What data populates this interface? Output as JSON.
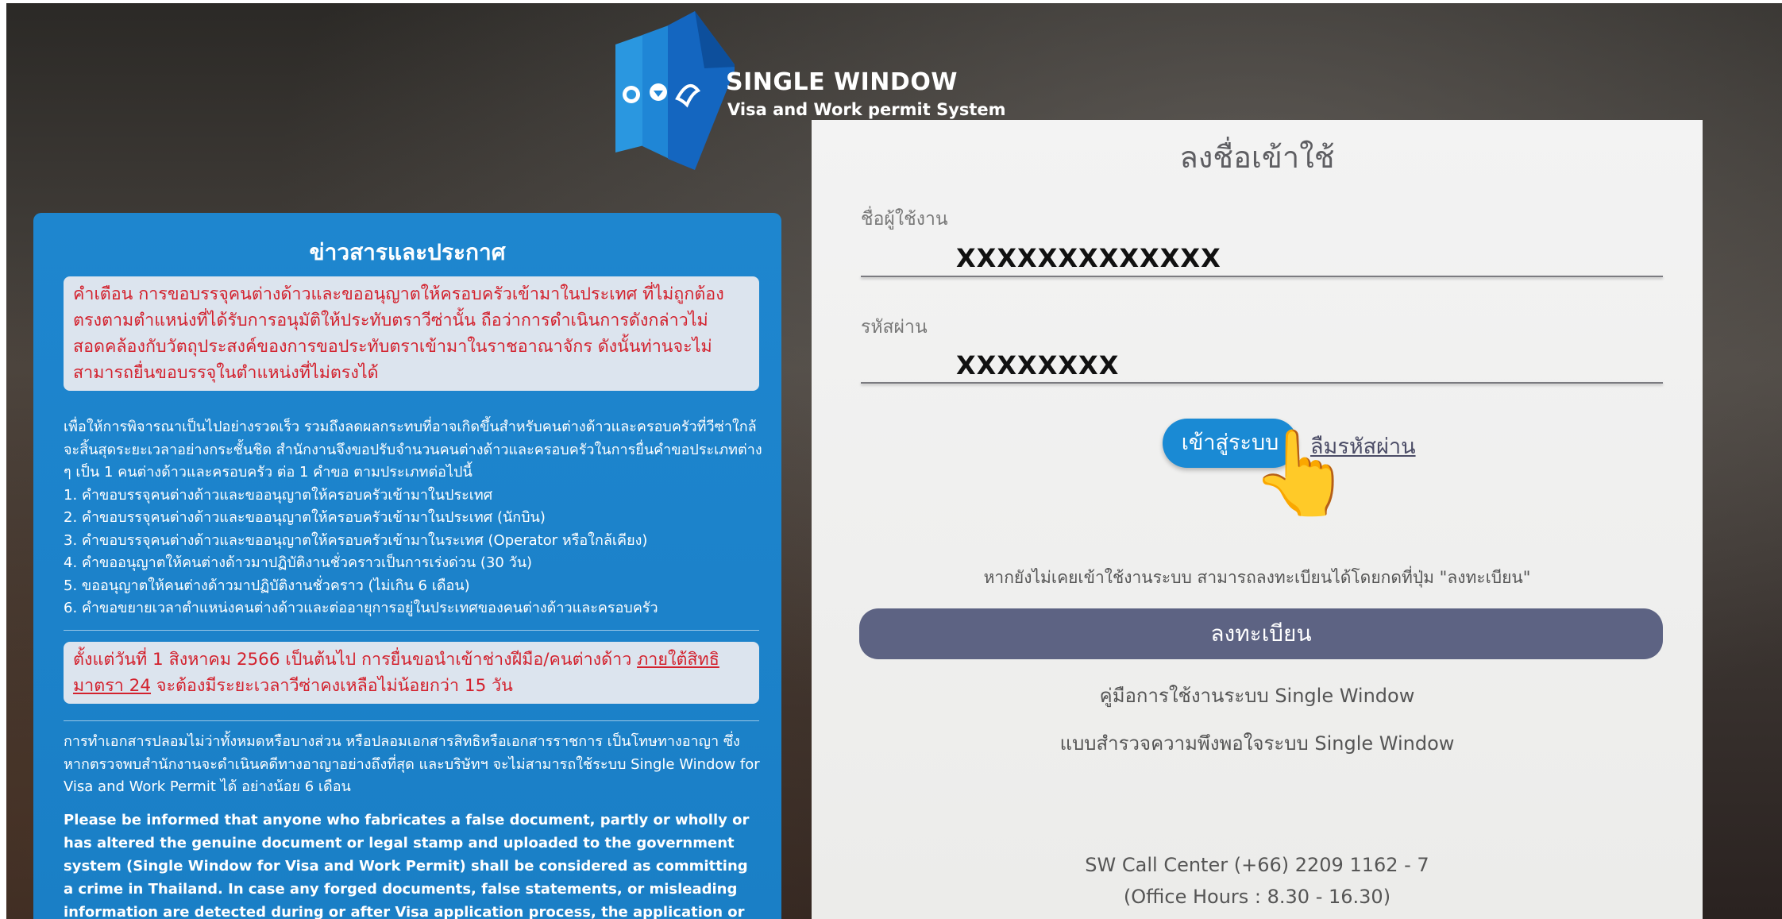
{
  "logo": {
    "title": "SINGLE WINDOW",
    "subtitle": "Visa and Work permit System"
  },
  "news": {
    "title": "ข่าวสารและประกาศ",
    "warning": "คำเตือน  การขอบรรจุคนต่างด้าวและขออนุญาตให้ครอบครัวเข้ามาในประเทศ  ที่ไม่ถูกต้องตรงตามตำแหน่งที่ได้รับการอนุมัติให้ประทับตราวีซ่านั้น ถือว่าการดำเนินการดังกล่าวไม่สอดคล้องกับวัตถุประสงค์ของการขอประทับตราเข้ามาในราชอาณาจักร ดังนั้นท่านจะไม่สามารถยื่นขอบรรจุในตำแหน่งที่ไม่ตรงได้",
    "intro": "เพื่อให้การพิจารณาเป็นไปอย่างรวดเร็ว รวมถึงลดผลกระทบที่อาจเกิดขึ้นสำหรับคนต่างด้าวและครอบครัวที่วีซ่าใกล้จะสิ้นสุดระยะเวลาอย่างกระชั้นชิด สำนักงานจึงขอปรับจำนวนคนต่างด้าวและครอบครัวในการยื่นคำขอประเภทต่าง ๆ เป็น 1 คนต่างด้าวและครอบครัว ต่อ 1 คำขอ ตามประเภทต่อไปนี้",
    "items": [
      "1. คำขอบรรจุคนต่างด้าวและขออนุญาตให้ครอบครัวเข้ามาในประเทศ",
      "2. คำขอบรรจุคนต่างด้าวและขออนุญาตให้ครอบครัวเข้ามาในประเทศ (นักบิน)",
      "3. คำขอบรรจุคนต่างด้าวและขออนุญาตให้ครอบครัวเข้ามาในระเทศ (Operator หรือใกล้เคียง)",
      "4. คำขออนุญาตให้คนต่างด้าวมาปฏิบัติงานชั่วคราวเป็นการเร่งด่วน (30 วัน)",
      "5. ขออนุญาตให้คนต่างด้าวมาปฏิบัติงานชั่วคราว (ไม่เกิน 6 เดือน)",
      "6. คำขอขยายเวลาตำแหน่งคนต่างด้าวและต่ออายุการอยู่ในประเทศของคนต่างด้าวและครอบครัว"
    ],
    "notice2_pre": "ตั้งแต่วันที่ 1 สิงหาคม 2566 เป็นต้นไป การยื่นขอนำเข้าช่างฝีมือ/คนต่างด้าว ",
    "notice2_link": "ภายใต้สิทธิมาตรา 24",
    "notice2_post": " จะต้องมีระยะเวลาวีซ่าคงเหลือไม่น้อยกว่า 15 วัน",
    "fraud_th": "การทำเอกสารปลอมไม่ว่าทั้งหมดหรือบางส่วน หรือปลอมเอกสารสิทธิหรือเอกสารราชการ เป็นโทษทางอาญา ซึ่งหากตรวจพบสำนักงานจะดำเนินคดีทางอาญาอย่างถึงที่สุด และบริษัทฯ จะไม่สามารถใช้ระบบ Single Window for Visa and Work Permit ได้ อย่างน้อย 6 เดือน",
    "fraud_en": "Please be informed that anyone who fabricates a false document, partly or wholly or has altered the genuine document or legal stamp and uploaded to the government system (Single Window for Visa and Work Permit) shall be considered as committing a crime in Thailand. In case any forged documents, false statements, or misleading information are detected during or after Visa application process, the application or the visa will be rejected or terminated"
  },
  "login": {
    "title": "ลงชื่อเข้าใช้",
    "username_label": "ชื่อผู้ใช้งาน",
    "username_value": "XXXXXXXXXXXXX",
    "password_label": "รหัสผ่าน",
    "password_value": "XXXXXXXX",
    "login_button": "เข้าสู่ระบบ",
    "forgot_link": "ลืมรหัสผ่าน",
    "hand_emoji": "👆",
    "register_hint": "หากยังไม่เคยเข้าใช้งานระบบ สามารถลงทะเบียนได้โดยกดที่ปุ่ม \"ลงทะเบียน\"",
    "register_button": "ลงทะเบียน",
    "manual_link": "คู่มือการใช้งานระบบ Single Window",
    "survey_link": "แบบสำรวจความพึงพอใจระบบ Single Window",
    "call_center": "SW Call Center (+66) 2209 1162 - 7",
    "office_hours": "(Office Hours : 8.30 - 16.30)"
  },
  "colors": {
    "panel_blue": "#1e86cf",
    "warning_red": "#d3212d",
    "login_blue": "#1a8ad4",
    "register_slate": "#5d6383"
  }
}
